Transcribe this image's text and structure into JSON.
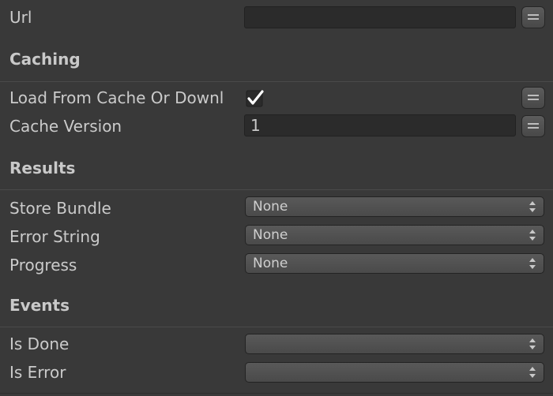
{
  "fields": {
    "url": {
      "label": "Url",
      "value": ""
    },
    "caching_header": "Caching",
    "load_from_cache": {
      "label": "Load From Cache Or Downl",
      "checked": true
    },
    "cache_version": {
      "label": "Cache Version",
      "value": "1"
    },
    "results_header": "Results",
    "store_bundle": {
      "label": "Store Bundle",
      "value": "None"
    },
    "error_string": {
      "label": "Error String",
      "value": "None"
    },
    "progress": {
      "label": "Progress",
      "value": "None"
    },
    "events_header": "Events",
    "is_done": {
      "label": "Is Done",
      "value": ""
    },
    "is_error": {
      "label": "Is Error",
      "value": ""
    }
  },
  "icons": {
    "variable_toggle": "equals-icon",
    "dropdown_arrow": "up-down-arrows-icon",
    "check": "checkmark-icon"
  },
  "colors": {
    "background": "#393939",
    "text": "#cbcbcb",
    "field_background": "#2b2b2b"
  }
}
